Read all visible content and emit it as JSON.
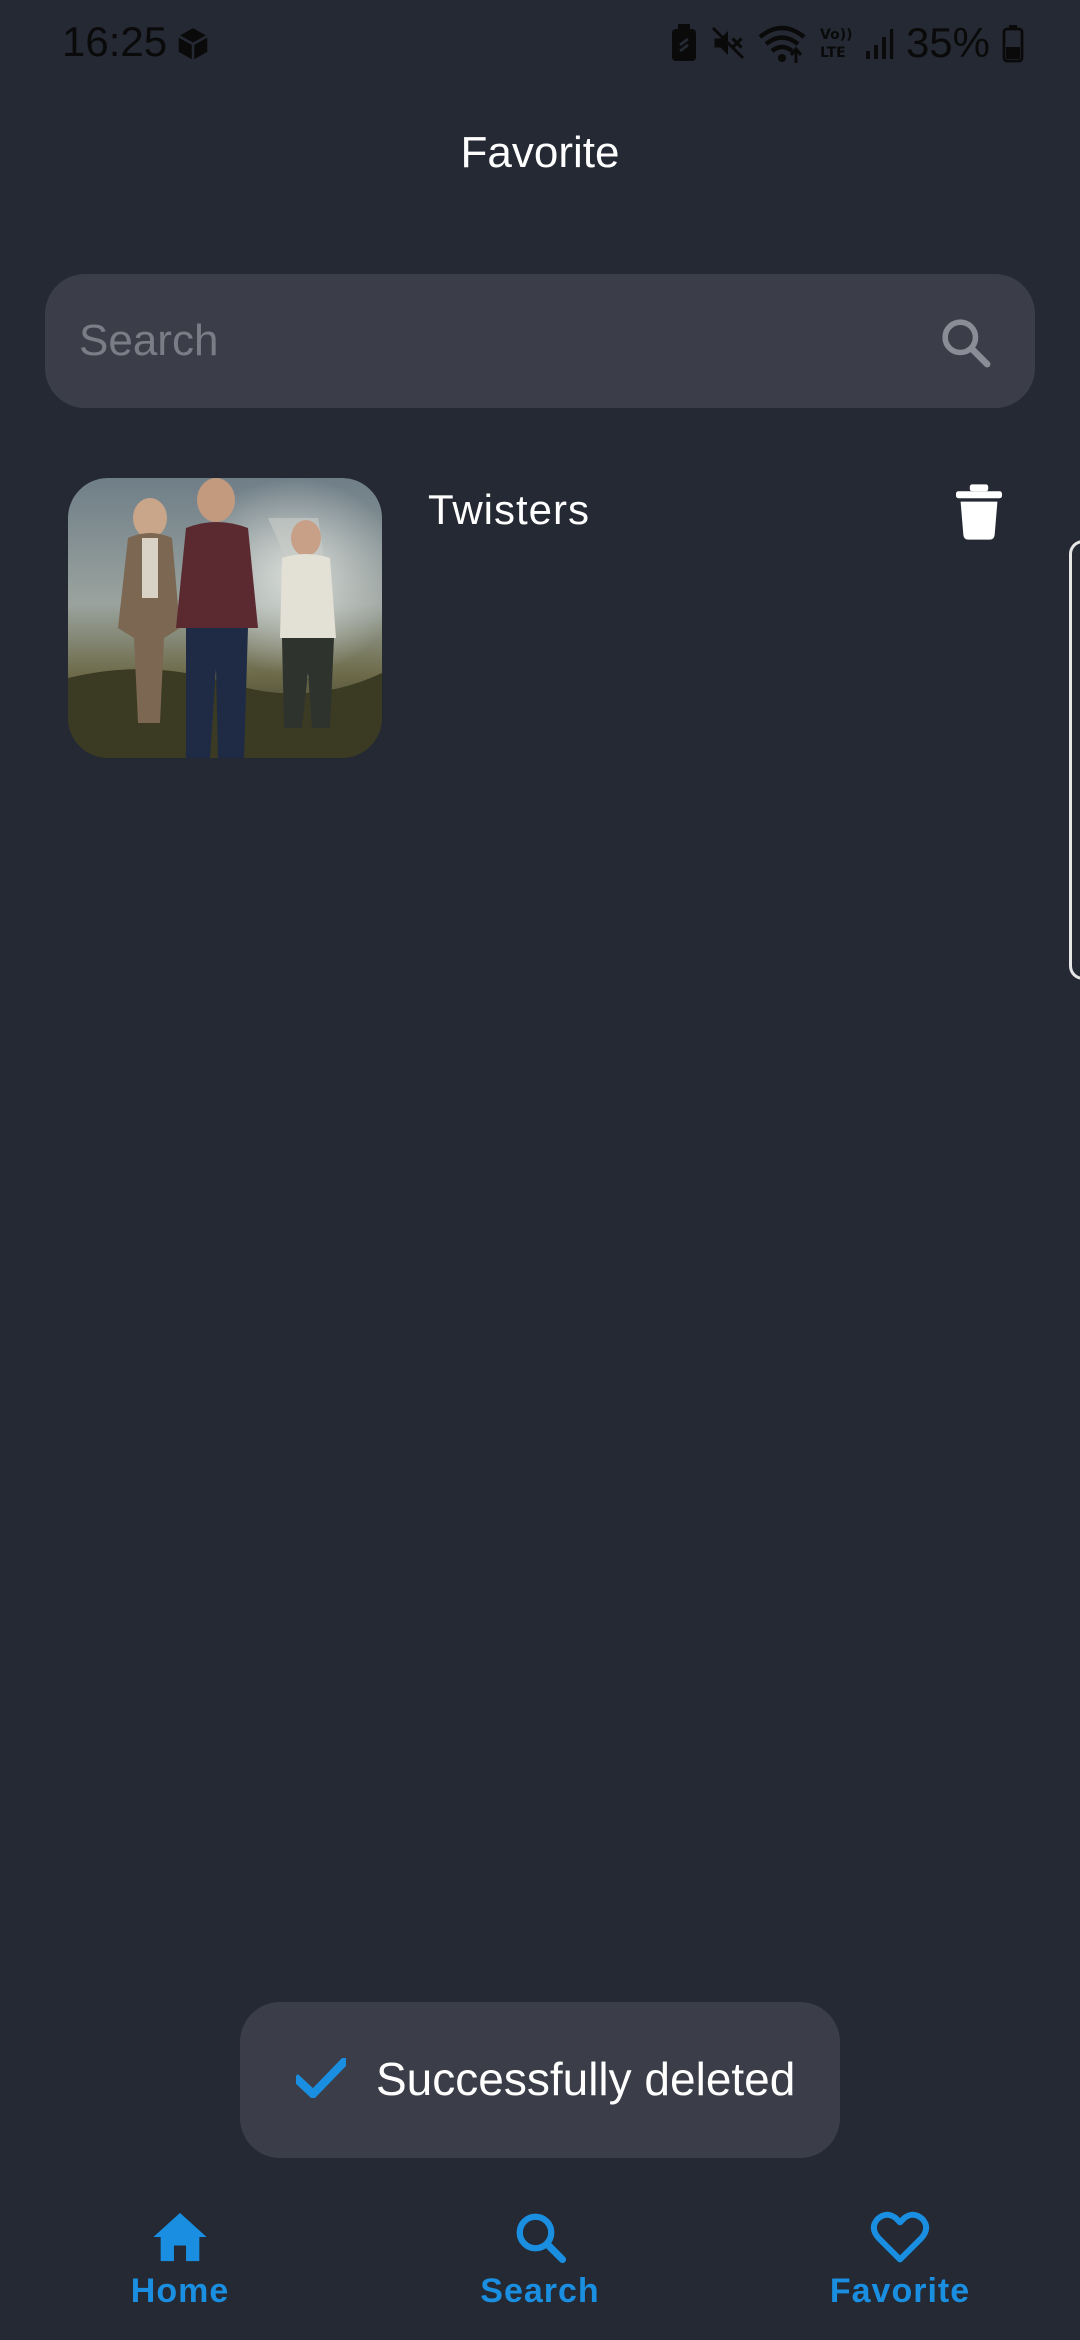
{
  "status_bar": {
    "time": "16:25",
    "battery_percent": "35%",
    "icons": [
      "package-icon",
      "battery-saver-icon",
      "mute-icon",
      "wifi-icon",
      "volte-icon",
      "signal-icon",
      "battery-icon"
    ]
  },
  "header": {
    "title": "Favorite"
  },
  "search": {
    "placeholder": "Search",
    "value": "",
    "icon": "search-icon"
  },
  "favorites": [
    {
      "title": "Twisters",
      "thumbnail": "movie-poster",
      "action_icon": "trash-icon"
    }
  ],
  "toast": {
    "icon": "check-icon",
    "message": "Successfully deleted"
  },
  "bottom_nav": {
    "items": [
      {
        "label": "Home",
        "icon": "home-icon"
      },
      {
        "label": "Search",
        "icon": "search-icon"
      },
      {
        "label": "Favorite",
        "icon": "heart-icon",
        "active": true
      }
    ]
  },
  "colors": {
    "background": "#242933",
    "surface": "#3b3e48",
    "accent": "#1a8ee0",
    "text": "#ffffff"
  }
}
